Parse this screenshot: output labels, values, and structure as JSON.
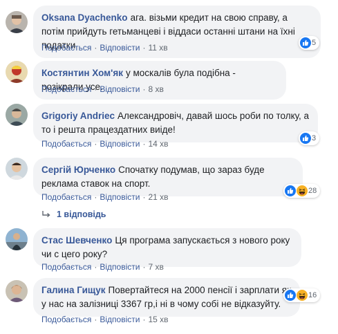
{
  "common": {
    "like_label": "Подобається",
    "reply_label": "Відповісти",
    "dot": "·"
  },
  "colors": {
    "link": "#385898",
    "bubble": "#f2f3f5",
    "meta": "#606770",
    "like_blue": "#1877f2",
    "haha_yellow": "#f7b125"
  },
  "comments": [
    {
      "author": "Oksana Dyachenko",
      "text": "ага. візьми кредит на свою справу, а потім прийдуть гетьманцеві і віддаси останні штани на їхні податки",
      "time": "11 хв",
      "reactions": [
        "like-icon"
      ],
      "reaction_count": "5"
    },
    {
      "author": "Костянтин Хом'як",
      "text": "у москалів була подібна - розікрали усе.",
      "time": "8 хв"
    },
    {
      "author": "Grigoriy Andriec",
      "text": "Александровіч, давай шось роби по толку, а то і решта працездатних виіде!",
      "time": "14 хв",
      "reactions": [
        "like-icon"
      ],
      "reaction_count": "3"
    },
    {
      "author": "Сергій Юрченко",
      "text": "Спочатку подумав, що зараз буде реклама ставок на спорт.",
      "time": "21 хв",
      "reactions": [
        "like-icon",
        "haha-icon"
      ],
      "reaction_count": "28",
      "replies_label": "1 відповідь"
    },
    {
      "author": "Стас Шевченко",
      "text": "Ця програма запускається з нового року чи с цего року?",
      "time": "7 хв"
    },
    {
      "author": "Галина Гищук",
      "text": "Повертайтеся на 2000 пенсії і зарплати як у нас на залізниці 3367 гр,і ні в чому собі не відказуйту.",
      "time": "15 хв",
      "reactions": [
        "like-icon",
        "haha-icon"
      ],
      "reaction_count": "16"
    }
  ]
}
